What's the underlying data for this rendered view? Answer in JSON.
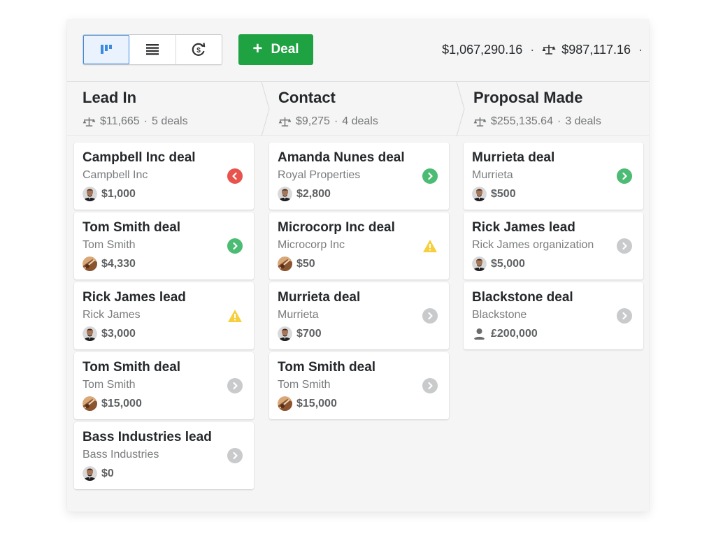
{
  "toolbar": {
    "views": [
      {
        "name": "pipeline-view",
        "icon": "pipeline-icon",
        "active": true
      },
      {
        "name": "list-view",
        "icon": "list-icon",
        "active": false
      },
      {
        "name": "forecast-view",
        "icon": "forecast-icon",
        "active": false
      }
    ],
    "add_deal_plus": "+",
    "add_deal_label": "Deal",
    "total_value": "$1,067,290.16",
    "separator": "·",
    "weighted_value": "$987,117.16",
    "trailing_separator": "·"
  },
  "colors": {
    "accent_green": "#1ea242",
    "status_green": "#4cbb74",
    "status_red": "#e8534c",
    "status_yellow": "#f7cf3d",
    "status_gray": "#c9cacb",
    "active_view_blue": "#3c8ae0"
  },
  "stages": [
    {
      "title": "Lead In",
      "value": "$11,665",
      "dot": "·",
      "count": "5 deals",
      "deals": [
        {
          "title": "Campbell Inc deal",
          "org": "Campbell Inc",
          "value": "$1,000",
          "avatar": "man-beard",
          "status": "overdue"
        },
        {
          "title": "Tom Smith deal",
          "org": "Tom Smith",
          "value": "$4,330",
          "avatar": "guitar",
          "status": "planned"
        },
        {
          "title": "Rick James lead",
          "org": "Rick James",
          "value": "$3,000",
          "avatar": "man-beard",
          "status": "warning"
        },
        {
          "title": "Tom Smith deal",
          "org": "Tom Smith",
          "value": "$15,000",
          "avatar": "guitar",
          "status": "none"
        },
        {
          "title": "Bass Industries lead",
          "org": "Bass Industries",
          "value": "$0",
          "avatar": "man-beard",
          "status": "none"
        }
      ]
    },
    {
      "title": "Contact",
      "value": "$9,275",
      "dot": "·",
      "count": "4 deals",
      "deals": [
        {
          "title": "Amanda Nunes deal",
          "org": "Royal Properties",
          "value": "$2,800",
          "avatar": "man-beard",
          "status": "planned"
        },
        {
          "title": "Microcorp Inc deal",
          "org": "Microcorp Inc",
          "value": "$50",
          "avatar": "guitar",
          "status": "warning"
        },
        {
          "title": "Murrieta deal",
          "org": "Murrieta",
          "value": "$700",
          "avatar": "man-beard",
          "status": "none"
        },
        {
          "title": "Tom Smith deal",
          "org": "Tom Smith",
          "value": "$15,000",
          "avatar": "guitar",
          "status": "none"
        }
      ]
    },
    {
      "title": "Proposal Made",
      "value": "$255,135.64",
      "dot": "·",
      "count": "3 deals",
      "deals": [
        {
          "title": "Murrieta deal",
          "org": "Murrieta",
          "value": "$500",
          "avatar": "man-beard",
          "status": "planned"
        },
        {
          "title": "Rick James lead",
          "org": "Rick James organization",
          "value": "$5,000",
          "avatar": "man-beard",
          "status": "none"
        },
        {
          "title": "Blackstone deal",
          "org": "Blackstone",
          "value": "£200,000",
          "avatar": "person-placeholder",
          "status": "none"
        }
      ]
    }
  ]
}
